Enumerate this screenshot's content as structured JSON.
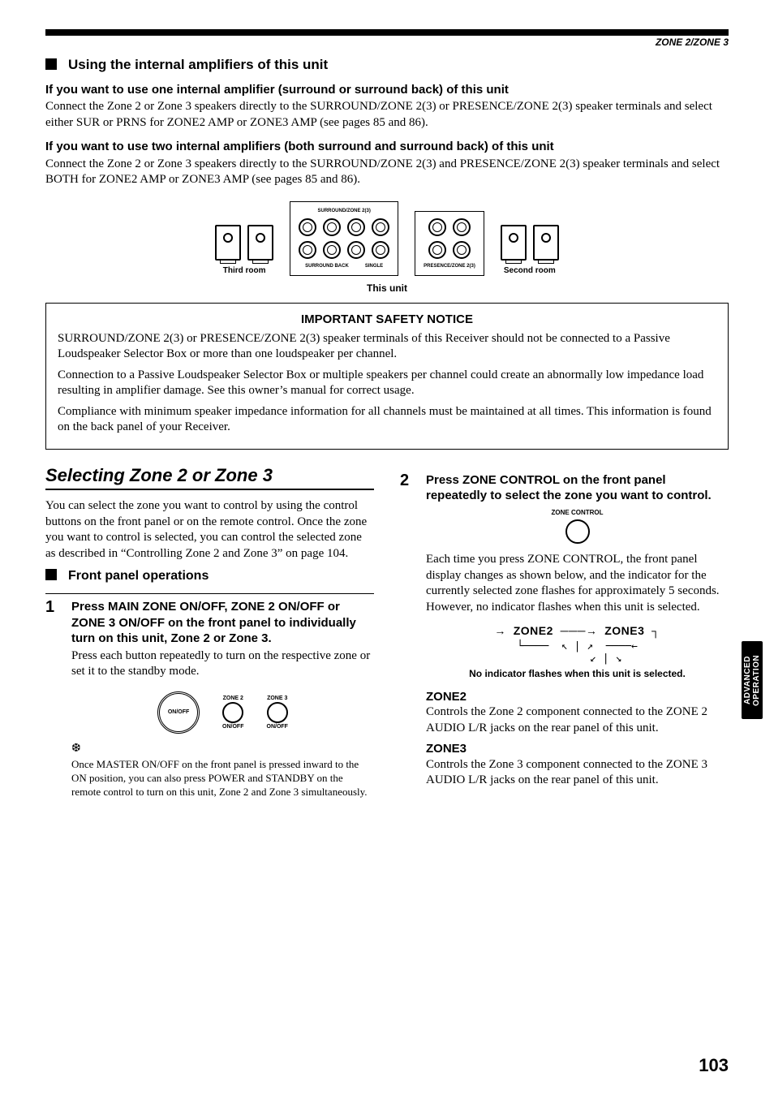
{
  "header": {
    "running_head": "ZONE 2/ZONE 3"
  },
  "h1": "Using the internal amplifiers of this unit",
  "one_amp": {
    "heading": "If you want to use one internal amplifier (surround or surround back) of this unit",
    "body": "Connect the Zone 2 or Zone 3 speakers directly to the SURROUND/ZONE 2(3) or PRESENCE/ZONE 2(3) speaker terminals and select either SUR or PRNS for ZONE2 AMP or ZONE3 AMP (see pages 85 and 86)."
  },
  "two_amp": {
    "heading": "If you want to use two internal amplifiers (both surround and surround back) of this unit",
    "body": "Connect the Zone 2 or Zone 3 speakers directly to the SURROUND/ZONE 2(3) and PRESENCE/ZONE 2(3) speaker terminals and select BOTH for ZONE2 AMP or ZONE3 AMP (see pages 85 and 86)."
  },
  "diagram": {
    "third_room": "Third room",
    "second_room": "Second room",
    "surround_zone": "SURROUND/ZONE 2(3)",
    "surround_back": "SURROUND BACK",
    "presence_zone": "PRESENCE/ZONE 2(3)",
    "single": "SINGLE",
    "this_unit": "This unit"
  },
  "notice": {
    "title": "IMPORTANT SAFETY NOTICE",
    "p1": "SURROUND/ZONE 2(3) or PRESENCE/ZONE 2(3) speaker terminals of this Receiver should not be connected to a Passive Loudspeaker Selector Box or more than one loudspeaker per channel.",
    "p2": "Connection to a Passive Loudspeaker Selector Box or multiple speakers per channel could create an abnormally low impedance load resulting in amplifier damage. See this owner’s manual for correct usage.",
    "p3": "Compliance with minimum speaker impedance information for all channels must be maintained at all times. This information is found on the back panel of your Receiver."
  },
  "left": {
    "section_title": "Selecting Zone 2 or Zone 3",
    "intro": "You can select the zone you want to control by using the control buttons on the front panel or on the remote control. Once the zone you want to control is selected, you can control the selected zone as described in “Controlling Zone 2 and Zone 3” on page 104.",
    "sub": "Front panel operations",
    "step1": {
      "num": "1",
      "bold": "Press MAIN ZONE ON/OFF, ZONE 2 ON/OFF or ZONE 3 ON/OFF on the front panel to individually turn on this unit, Zone 2 or Zone 3.",
      "body": "Press each button repeatedly to turn on the respective zone or set it to the standby mode."
    },
    "buttons": {
      "onoff": "ON/OFF",
      "zone2": "ZONE 2",
      "zone3": "ZONE 3",
      "onoff2": "ON/OFF",
      "onoff3": "ON/OFF"
    },
    "tip": "Once MASTER ON/OFF on the front panel is pressed inward to the ON position, you can also press POWER and STANDBY on the remote control to turn on this unit, Zone 2 and Zone 3 simultaneously."
  },
  "right": {
    "step2": {
      "num": "2",
      "bold": "Press ZONE CONTROL on the front panel repeatedly to select the zone you want to control.",
      "zone_control_label": "ZONE CONTROL",
      "body": "Each time you press ZONE CONTROL, the front panel display changes as shown below, and the indicator for the currently selected zone flashes for approximately 5 seconds. However, no indicator flashes when this unit is selected."
    },
    "cycle": {
      "zone2": "ZONE2",
      "zone3": "ZONE3",
      "caption": "No indicator flashes when this unit is selected."
    },
    "zone2": {
      "label": "ZONE2",
      "body": "Controls the Zone 2 component connected to the ZONE 2 AUDIO L/R jacks on the rear panel of this unit."
    },
    "zone3": {
      "label": "ZONE3",
      "body": "Controls the Zone 3 component connected to the ZONE 3 AUDIO L/R jacks on the rear panel of this unit."
    }
  },
  "side_tab": "ADVANCED\nOPERATION",
  "page_number": "103"
}
